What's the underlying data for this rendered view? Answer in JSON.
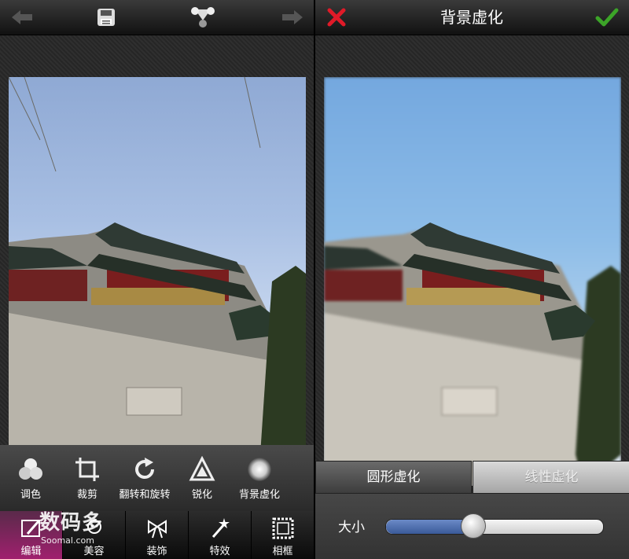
{
  "header": {
    "title": "背景虚化",
    "icons": {
      "undo": "undo-icon",
      "save": "save-icon",
      "share": "share-icon",
      "redo": "redo-icon",
      "cancel": "cancel-icon",
      "confirm": "confirm-icon"
    },
    "colors": {
      "cancel": "#e01a28",
      "confirm": "#3ca428"
    }
  },
  "tools": [
    {
      "label": "调色",
      "icon": "color-adjust-icon"
    },
    {
      "label": "裁剪",
      "icon": "crop-icon"
    },
    {
      "label": "翻转和旋转",
      "icon": "rotate-icon"
    },
    {
      "label": "锐化",
      "icon": "sharpen-icon"
    },
    {
      "label": "背景虚化",
      "icon": "blur-background-icon"
    }
  ],
  "tabs": [
    {
      "label": "编辑",
      "icon": "edit-icon",
      "active": true
    },
    {
      "label": "美容",
      "icon": "beauty-icon",
      "active": false
    },
    {
      "label": "装饰",
      "icon": "decoration-icon",
      "active": false
    },
    {
      "label": "特效",
      "icon": "effects-icon",
      "active": false
    },
    {
      "label": "相框",
      "icon": "frame-icon",
      "active": false
    }
  ],
  "blur_modes": {
    "circular": "圆形虚化",
    "linear": "线性虚化",
    "selected": "circular"
  },
  "size": {
    "label": "大小",
    "value": 0.4
  },
  "watermark": {
    "text": "数码多",
    "site": "Soomal.com"
  }
}
